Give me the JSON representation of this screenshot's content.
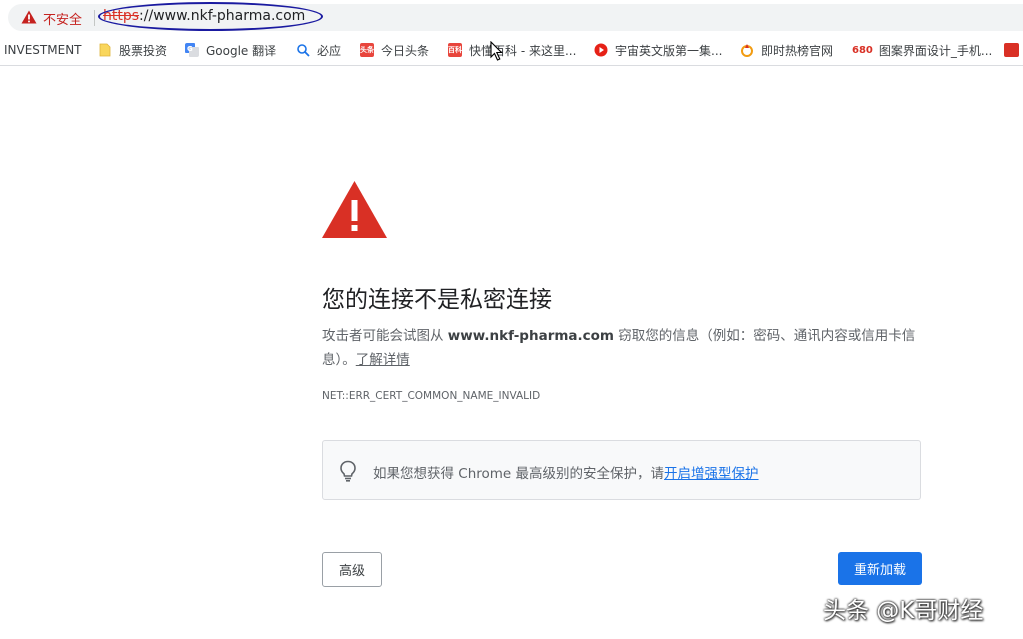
{
  "address_bar": {
    "security_label": "不安全",
    "url_scheme": "https",
    "url_rest": "://www.nkf-pharma.com"
  },
  "bookmarks": [
    {
      "label": "INVESTMENT",
      "icon": "none"
    },
    {
      "label": "股票投资",
      "icon": "folder-icon",
      "color": "#f9d65c"
    },
    {
      "label": "Google 翻译",
      "icon": "google-translate-icon",
      "color": "#4285f4"
    },
    {
      "label": "必应",
      "icon": "bing-search-icon",
      "color": "#1a73e8"
    },
    {
      "label": "今日头条",
      "icon": "toutiao-icon",
      "color": "#e8453c",
      "glyph": "头条"
    },
    {
      "label": "快懂百科 - 来这里...",
      "icon": "baike-icon",
      "color": "#e8453c",
      "glyph": "百科"
    },
    {
      "label": "宇宙英文版第一集...",
      "icon": "play-icon",
      "color": "#e62117"
    },
    {
      "label": "即时热榜官网",
      "icon": "hot-list-icon",
      "color": "#f29c12"
    },
    {
      "label": "图案界面设计_手机...",
      "icon": "680-icon",
      "color": "#d93025",
      "glyph": "680"
    },
    {
      "label": "",
      "icon": "extra-bookmark-icon",
      "color": "#d93025"
    }
  ],
  "interstitial": {
    "headline": "您的连接不是私密连接",
    "explanation_prefix": "攻击者可能会试图从 ",
    "explanation_host": "www.nkf-pharma.com",
    "explanation_suffix": " 窃取您的信息（例如：密码、通讯内容或信用卡信息）。",
    "learn_more": "了解详情",
    "error_code": "NET::ERR_CERT_COMMON_NAME_INVALID",
    "protection_text": "如果您想获得 Chrome 最高级别的安全保护，请",
    "protection_link": "开启增强型保护",
    "advanced_button": "高级",
    "reload_button": "重新加载"
  },
  "watermark": "头条 @K哥财经",
  "colors": {
    "warning_red": "#d93025",
    "link_blue": "#1a73e8",
    "annotation_circle": "#1a1aa0"
  }
}
